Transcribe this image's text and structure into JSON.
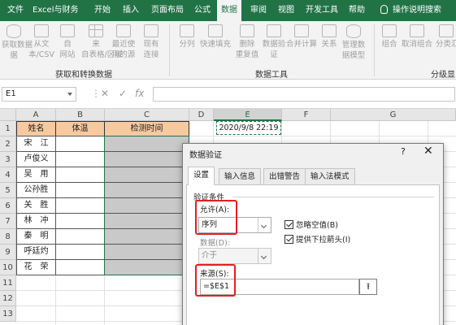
{
  "ribbon": {
    "tabs": [
      "文件",
      "Excel与财务",
      "开始",
      "插入",
      "页面布局",
      "公式",
      "数据",
      "审阅",
      "视图",
      "开发工具",
      "帮助"
    ],
    "active_tab": "数据",
    "tell_me": "操作说明搜索",
    "buttons": [
      {
        "label": "获取数据",
        "label2": "据"
      },
      {
        "label": "从文",
        "label2": "本/CSV"
      },
      {
        "label": "自",
        "label2": "网站"
      },
      {
        "label": "来",
        "label2": "自表格/区域"
      },
      {
        "label": "最近使",
        "label2": "用的源"
      },
      {
        "label": "现有",
        "label2": "连接"
      },
      {
        "label": "分列",
        "label2": ""
      },
      {
        "label": "快速填充",
        "label2": ""
      },
      {
        "label": "删除",
        "label2": "重复值"
      },
      {
        "label": "数据验",
        "label2": "证"
      },
      {
        "label": "合并计算",
        "label2": ""
      },
      {
        "label": "关系",
        "label2": ""
      },
      {
        "label": "管理数",
        "label2": "据模型"
      },
      {
        "label": "组合",
        "label2": ""
      },
      {
        "label": "取消组合",
        "label2": ""
      },
      {
        "label": "分类汇",
        "label2": ""
      }
    ],
    "groups": [
      "获取和转换数据",
      "数据工具",
      "分级显"
    ]
  },
  "formula_bar": {
    "name_box": "E1",
    "cancel_icon": "✕",
    "enter_icon": "✓",
    "fx_icon": "fx",
    "value": ""
  },
  "sheet": {
    "columns": [
      "A",
      "B",
      "C",
      "D",
      "E",
      "F",
      "G"
    ],
    "rows": [
      "1",
      "2",
      "3",
      "4",
      "5",
      "6",
      "7",
      "8",
      "9",
      "10",
      "11",
      "12",
      "13"
    ],
    "headers": [
      "姓名",
      "体温",
      "检测时间"
    ],
    "names": [
      "宋　江",
      "卢俊义",
      "吴　用",
      "公孙胜",
      "关　胜",
      "林　冲",
      "秦　明",
      "呼廷灼",
      "花　荣"
    ],
    "e1_value": "2020/9/8 22:19"
  },
  "dialog": {
    "title": "数据验证",
    "help": "?",
    "close": "✕",
    "tabs": [
      "设置",
      "输入信息",
      "出错警告",
      "输入法模式"
    ],
    "active_tab": "设置",
    "criteria_label": "验证条件",
    "allow_label": "允许(A):",
    "allow_value": "序列",
    "ignore_blank": "忽略空值(B)",
    "dropdown_arrow": "提供下拉箭头(I)",
    "data_label": "数据(D):",
    "data_value": "介于",
    "source_label": "来源(S):",
    "source_value": "=$E$1",
    "collapse_icon": "⭱"
  },
  "colors": {
    "excel_green": "#217346",
    "header_fill": "#f7c99f",
    "highlight": "#e02020"
  }
}
